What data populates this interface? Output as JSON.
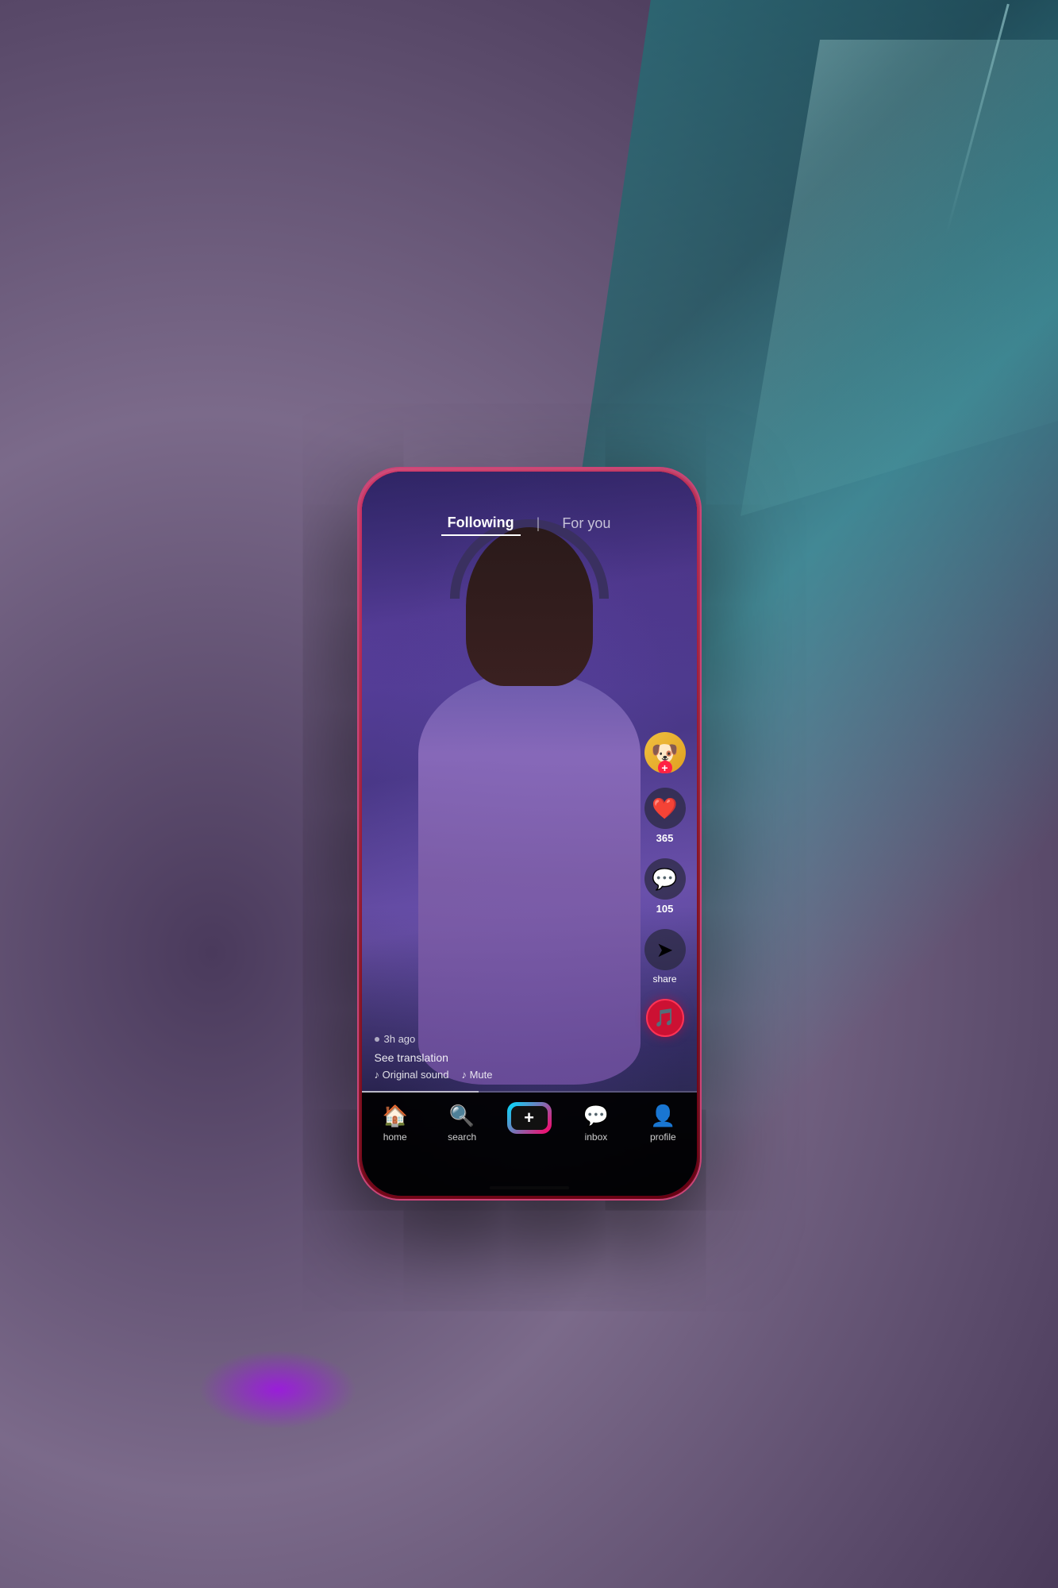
{
  "background": {
    "color": "#6b5b7b"
  },
  "phone": {
    "screen": {
      "top_nav": {
        "following_label": "Following",
        "divider": "|",
        "for_you_label": "For you",
        "active_tab": "following"
      },
      "video": {
        "timestamp": "3h ago",
        "translation_label": "See translation",
        "sound_original": "♪ Original sound",
        "sound_mute": "♪ Mute"
      },
      "right_actions": {
        "avatar_emoji": "🐶",
        "like_count": "365",
        "comment_count": "105",
        "share_label": "share",
        "music_icon": "♪"
      },
      "bottom_nav": {
        "home_label": "home",
        "search_label": "search",
        "add_label": "+",
        "inbox_label": "inbox",
        "profile_label": "profile"
      }
    }
  }
}
